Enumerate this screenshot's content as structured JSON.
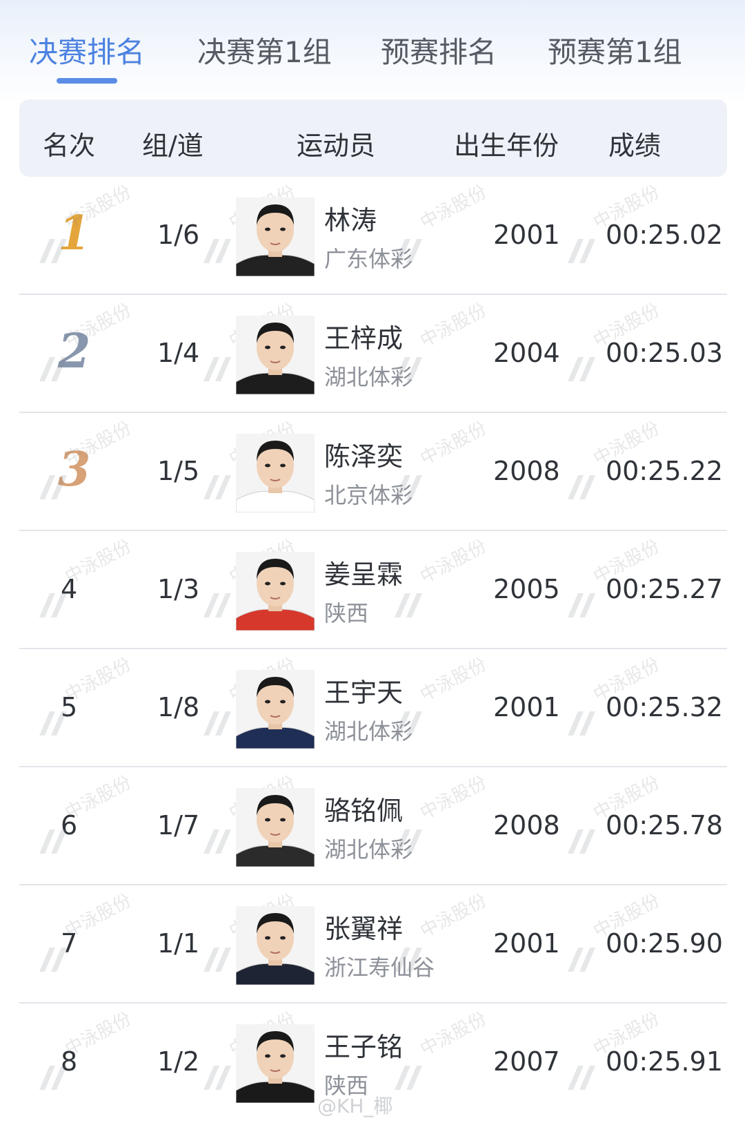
{
  "tabs": [
    {
      "label": "决赛排名",
      "active": true
    },
    {
      "label": "决赛第1组",
      "active": false
    },
    {
      "label": "预赛排名",
      "active": false
    },
    {
      "label": "预赛第1组",
      "active": false
    }
  ],
  "table": {
    "columns": [
      "名次",
      "组/道",
      "运动员",
      "出生年份",
      "成绩"
    ],
    "rows": [
      {
        "rank": "1",
        "lane": "1/6",
        "name": "林涛",
        "team": "广东体彩",
        "year": "2001",
        "result": "00:25.02"
      },
      {
        "rank": "2",
        "lane": "1/4",
        "name": "王梓成",
        "team": "湖北体彩",
        "year": "2004",
        "result": "00:25.03"
      },
      {
        "rank": "3",
        "lane": "1/5",
        "name": "陈泽奕",
        "team": "北京体彩",
        "year": "2008",
        "result": "00:25.22"
      },
      {
        "rank": "4",
        "lane": "1/3",
        "name": "姜呈霖",
        "team": "陕西",
        "year": "2005",
        "result": "00:25.27"
      },
      {
        "rank": "5",
        "lane": "1/8",
        "name": "王宇天",
        "team": "湖北体彩",
        "year": "2001",
        "result": "00:25.32"
      },
      {
        "rank": "6",
        "lane": "1/7",
        "name": "骆铭佩",
        "team": "湖北体彩",
        "year": "2008",
        "result": "00:25.78"
      },
      {
        "rank": "7",
        "lane": "1/1",
        "name": "张翼祥",
        "team": "浙江寿仙谷",
        "year": "2001",
        "result": "00:25.90"
      },
      {
        "rank": "8",
        "lane": "1/2",
        "name": "王子铭",
        "team": "陕西",
        "year": "2007",
        "result": "00:25.91"
      }
    ]
  },
  "watermark": {
    "text": "中泳股份"
  },
  "footer": {
    "credit": "@KH_椰"
  },
  "colors": {
    "accent": "#4c82e0",
    "gold": "#e4a53c",
    "silver": "#8897ad",
    "bronze": "#d7a278"
  }
}
